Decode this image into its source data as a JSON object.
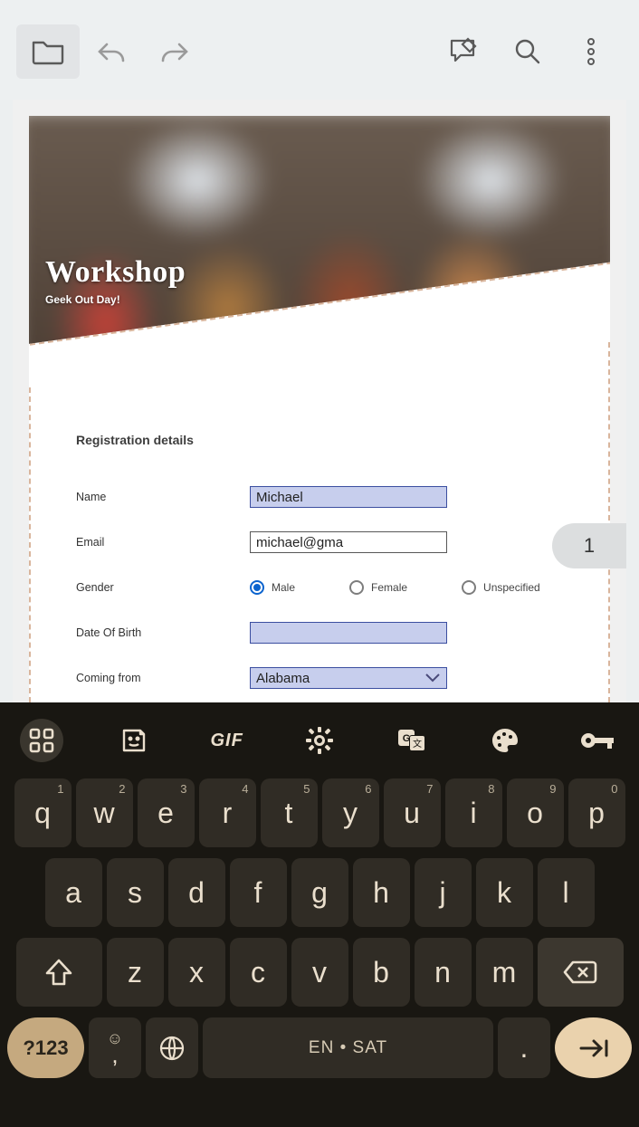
{
  "hero": {
    "title": "Workshop",
    "subtitle": "Geek Out Day!"
  },
  "section_title": "Registration details",
  "fields": {
    "name": {
      "label": "Name",
      "value": "Michael"
    },
    "email": {
      "label": "Email",
      "value": "michael@gma"
    },
    "gender": {
      "label": "Gender",
      "selected": "Male",
      "options": {
        "male": "Male",
        "female": "Female",
        "unspec": "Unspecified"
      }
    },
    "dob": {
      "label": "Date Of Birth",
      "value": ""
    },
    "from": {
      "label": "Coming from",
      "value": "Alabama"
    }
  },
  "page_number": "1",
  "keyboard": {
    "tools": {
      "gif": "GIF"
    },
    "row1": [
      {
        "k": "q",
        "s": "1"
      },
      {
        "k": "w",
        "s": "2"
      },
      {
        "k": "e",
        "s": "3"
      },
      {
        "k": "r",
        "s": "4"
      },
      {
        "k": "t",
        "s": "5"
      },
      {
        "k": "y",
        "s": "6"
      },
      {
        "k": "u",
        "s": "7"
      },
      {
        "k": "i",
        "s": "8"
      },
      {
        "k": "o",
        "s": "9"
      },
      {
        "k": "p",
        "s": "0"
      }
    ],
    "row2": [
      "a",
      "s",
      "d",
      "f",
      "g",
      "h",
      "j",
      "k",
      "l"
    ],
    "row3": [
      "z",
      "x",
      "c",
      "v",
      "b",
      "n",
      "m"
    ],
    "sym": "?123",
    "space": "EN • SAT",
    "period": "."
  }
}
